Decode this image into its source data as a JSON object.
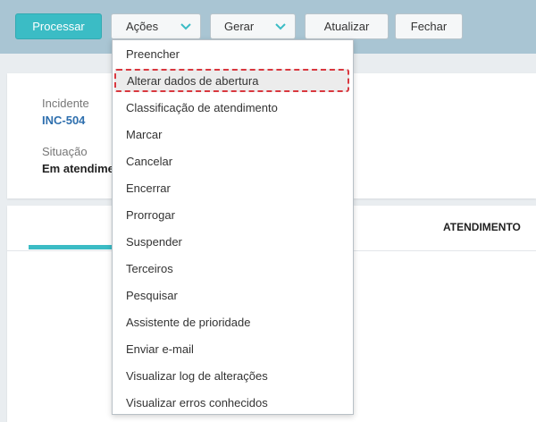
{
  "toolbar": {
    "process_label": "Processar",
    "actions_label": "Ações",
    "generate_label": "Gerar",
    "refresh_label": "Atualizar",
    "close_label": "Fechar"
  },
  "record": {
    "incident_label": "Incidente",
    "incident_value": "INC-504",
    "status_label": "Situação",
    "status_value": "Em atendimento"
  },
  "tabs": {
    "service_label": "ATENDIMENTO"
  },
  "actions_menu": {
    "items": [
      "Preencher",
      "Alterar dados de abertura",
      "Classificação de atendimento",
      "Marcar",
      "Cancelar",
      "Encerrar",
      "Prorrogar",
      "Suspender",
      "Terceiros",
      "Pesquisar",
      "Assistente de prioridade",
      "Enviar e-mail",
      "Visualizar log de alterações",
      "Visualizar erros conhecidos"
    ],
    "highlighted_index": 1
  },
  "colors": {
    "accent": "#3bbcc5",
    "toolbar_bg": "#a9c5d3",
    "link": "#2e6fae",
    "highlight_border": "#d9383f"
  }
}
